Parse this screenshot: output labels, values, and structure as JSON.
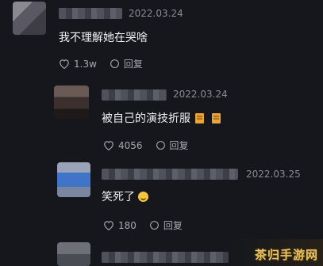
{
  "comments": [
    {
      "date": "2022.03.24",
      "text": "我不理解她在哭啥",
      "likes": "1.3w",
      "reply_label": "回复"
    },
    {
      "date": "2022.03.24",
      "text": "被自己的演技折服",
      "likes": "4056",
      "reply_label": "回复"
    },
    {
      "date": "2022.03.25",
      "text": "笑死了",
      "likes": "180",
      "reply_label": "回复"
    }
  ],
  "icons": {
    "like": "heart-icon",
    "reply": "reply-bubble-icon"
  },
  "watermark": "茶归手游网",
  "colors": {
    "background": "#15171d",
    "text": "#f1f1f4",
    "meta": "#8a8c96",
    "watermark": "#e8c468"
  }
}
